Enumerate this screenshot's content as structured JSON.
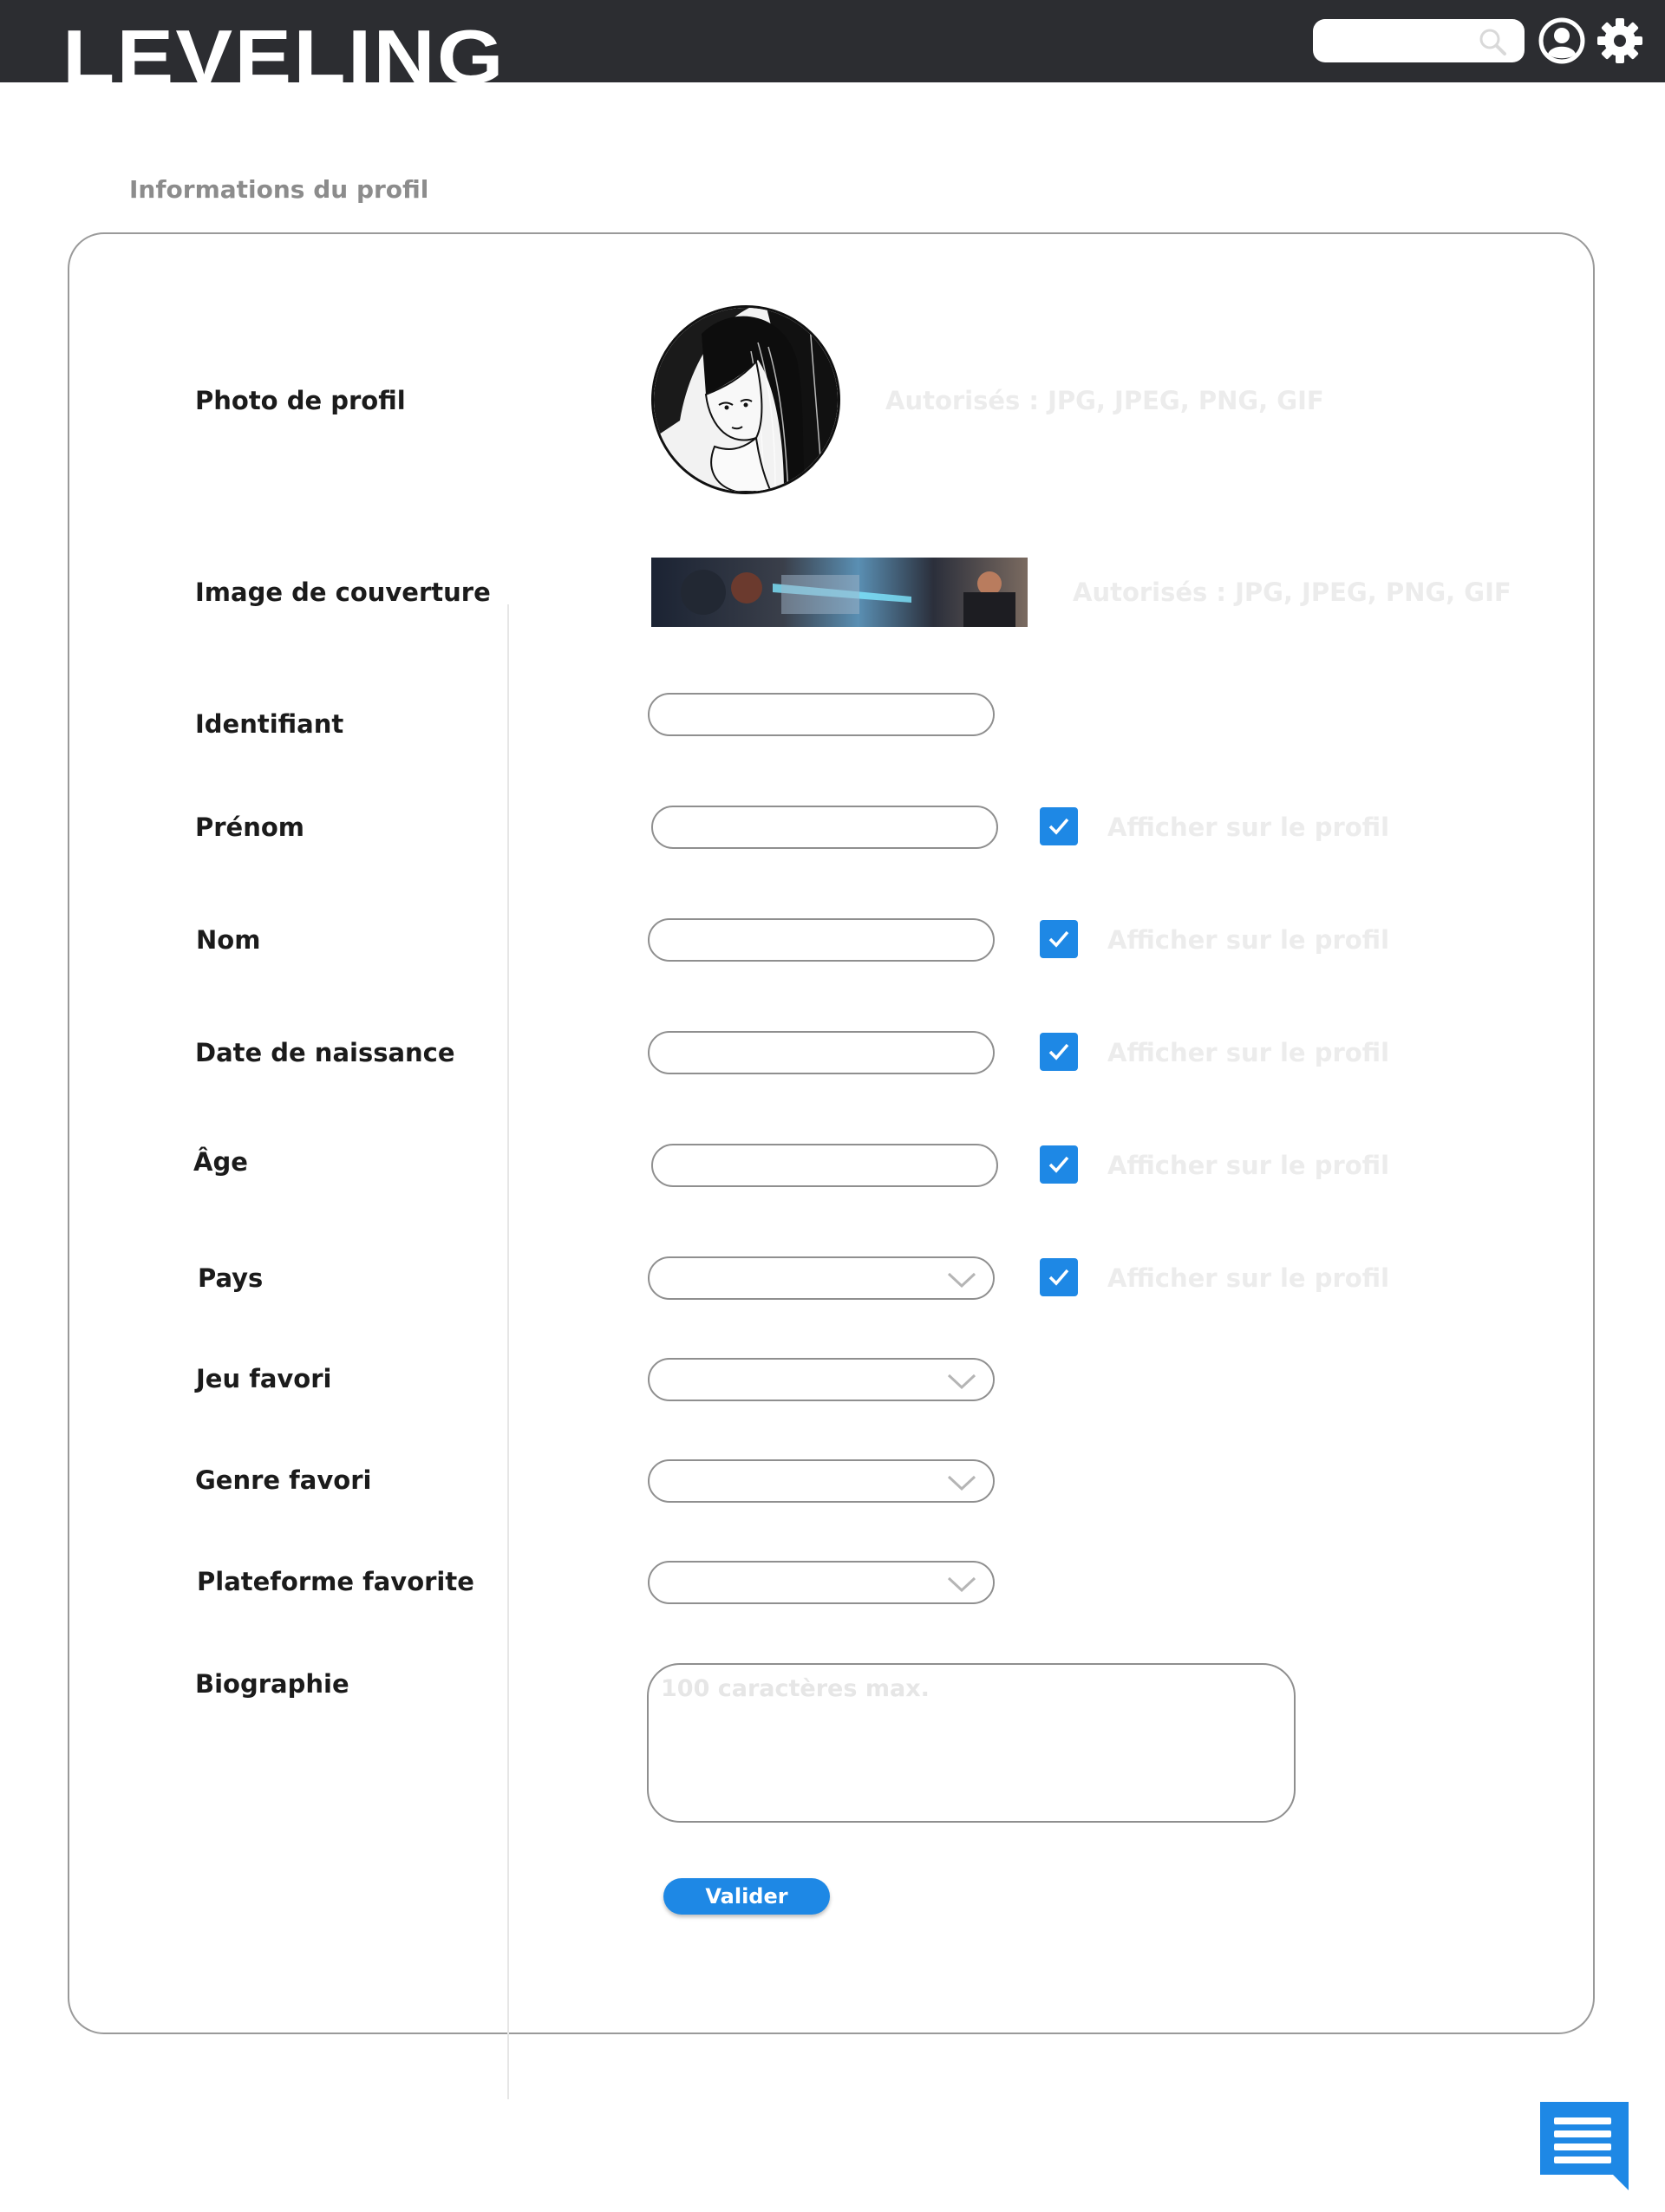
{
  "header": {
    "logo_text": "LEVELING",
    "search": {
      "value": "",
      "icon": "search-icon"
    },
    "account_icon": "user-icon",
    "settings_icon": "gear-icon"
  },
  "page": {
    "section_title": "Informations du profil"
  },
  "form": {
    "profile_photo": {
      "label": "Photo de profil",
      "hint": "Autorisés : JPG, JPEG, PNG, GIF"
    },
    "cover_image": {
      "label": "Image de couverture",
      "hint": "Autorisés : JPG, JPEG, PNG, GIF"
    },
    "username": {
      "label": "Identifiant",
      "value": ""
    },
    "first_name": {
      "label": "Prénom",
      "value": "",
      "show_on_profile": true,
      "show_label": "Afficher sur le profil"
    },
    "last_name": {
      "label": "Nom",
      "value": "",
      "show_on_profile": true,
      "show_label": "Afficher sur le profil"
    },
    "birth_date": {
      "label": "Date de naissance",
      "value": "",
      "show_on_profile": true,
      "show_label": "Afficher sur le profil"
    },
    "age": {
      "label": "Âge",
      "value": "",
      "show_on_profile": true,
      "show_label": "Afficher sur le profil"
    },
    "country": {
      "label": "Pays",
      "selected": "",
      "show_on_profile": true,
      "show_label": "Afficher sur le profil"
    },
    "favorite_game": {
      "label": "Jeu favori",
      "selected": ""
    },
    "favorite_genre": {
      "label": "Genre favori",
      "selected": ""
    },
    "favorite_platform": {
      "label": "Plateforme favorite",
      "selected": ""
    },
    "biography": {
      "label": "Biographie",
      "placeholder": "100 caractères max.",
      "value": ""
    },
    "submit_label": "Valider"
  },
  "colors": {
    "header_bg": "#2c2d31",
    "accent": "#1e88e5",
    "hint_text": "#ececec",
    "section_title": "#8c8c8c"
  },
  "chat_icon": "chat-icon"
}
